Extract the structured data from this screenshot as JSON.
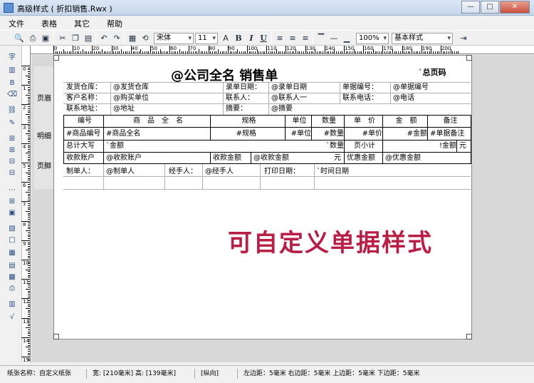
{
  "window": {
    "title": "高级样式 ( 折扣销售.Rwx )",
    "btn_min": "—",
    "btn_max": "□",
    "btn_close": "✕"
  },
  "menu": [
    "文件",
    "表格",
    "其它",
    "帮助"
  ],
  "toolbar": {
    "font_name": "宋体",
    "font_size": "11",
    "zoom": "100%",
    "style": "基本样式",
    "bold": "B",
    "italic": "I",
    "underline": "U"
  },
  "ruler": {
    "h_labels": [
      "0",
      "10",
      "20",
      "30",
      "40",
      "50",
      "60",
      "70",
      "80",
      "90",
      "100",
      "110",
      "120",
      "130",
      "140",
      "150",
      "160",
      "170",
      "180",
      "190",
      "200"
    ],
    "v_labels": [
      "0",
      "1",
      "2",
      "3",
      "4",
      "5",
      "6",
      "7",
      "8",
      "9",
      "10",
      "11",
      "12",
      "13",
      "14",
      "15"
    ]
  },
  "bands": {
    "header": "页眉",
    "detail": "明细",
    "footer": "页脚"
  },
  "report": {
    "title": "@公司全名  销售单",
    "page_code": "`总页码",
    "row1": [
      "发货仓库：",
      "@发货仓库",
      "录单日期：",
      "@录单日期",
      "单据编号：",
      "@单据编号"
    ],
    "row2": [
      "客户名称：",
      "@购买单位",
      "联系人：",
      "@联系人一",
      "联系电话：",
      "@电话"
    ],
    "row3": [
      "联系地址：",
      "@地址",
      "摘要：",
      "@摘要"
    ],
    "headers": [
      "编号",
      "商　品　全　名",
      "规格",
      "单位",
      "数量",
      "单　价",
      "金　额",
      "备注"
    ],
    "detail": [
      "#商品编号",
      "#商品全名",
      "#规格",
      "#单位",
      "#数量",
      "#单价",
      "#金额",
      "#单据备注"
    ],
    "total_row": [
      "总计大写",
      "`金额",
      "`数量",
      "页小计",
      "!金额",
      "元"
    ],
    "account_row": [
      "收款账户",
      "@收款账户",
      "收款金额",
      "@收款金额",
      "元",
      "优惠金额",
      "@优惠金额"
    ],
    "sign_row": [
      "制单人：",
      "@制单人",
      "经手人：",
      "@经手人",
      "打印日期：",
      "`时间日期"
    ]
  },
  "promo_text": "可自定义单据样式",
  "status": {
    "paper_name": "纸张名称：自定义纸张",
    "size": "宽: [210毫米] 高: [139毫米]",
    "orientation": "[纵向]",
    "margins": "左边距：5毫米 右边距：5毫米 上边距：5毫米 下边距：5毫米"
  }
}
